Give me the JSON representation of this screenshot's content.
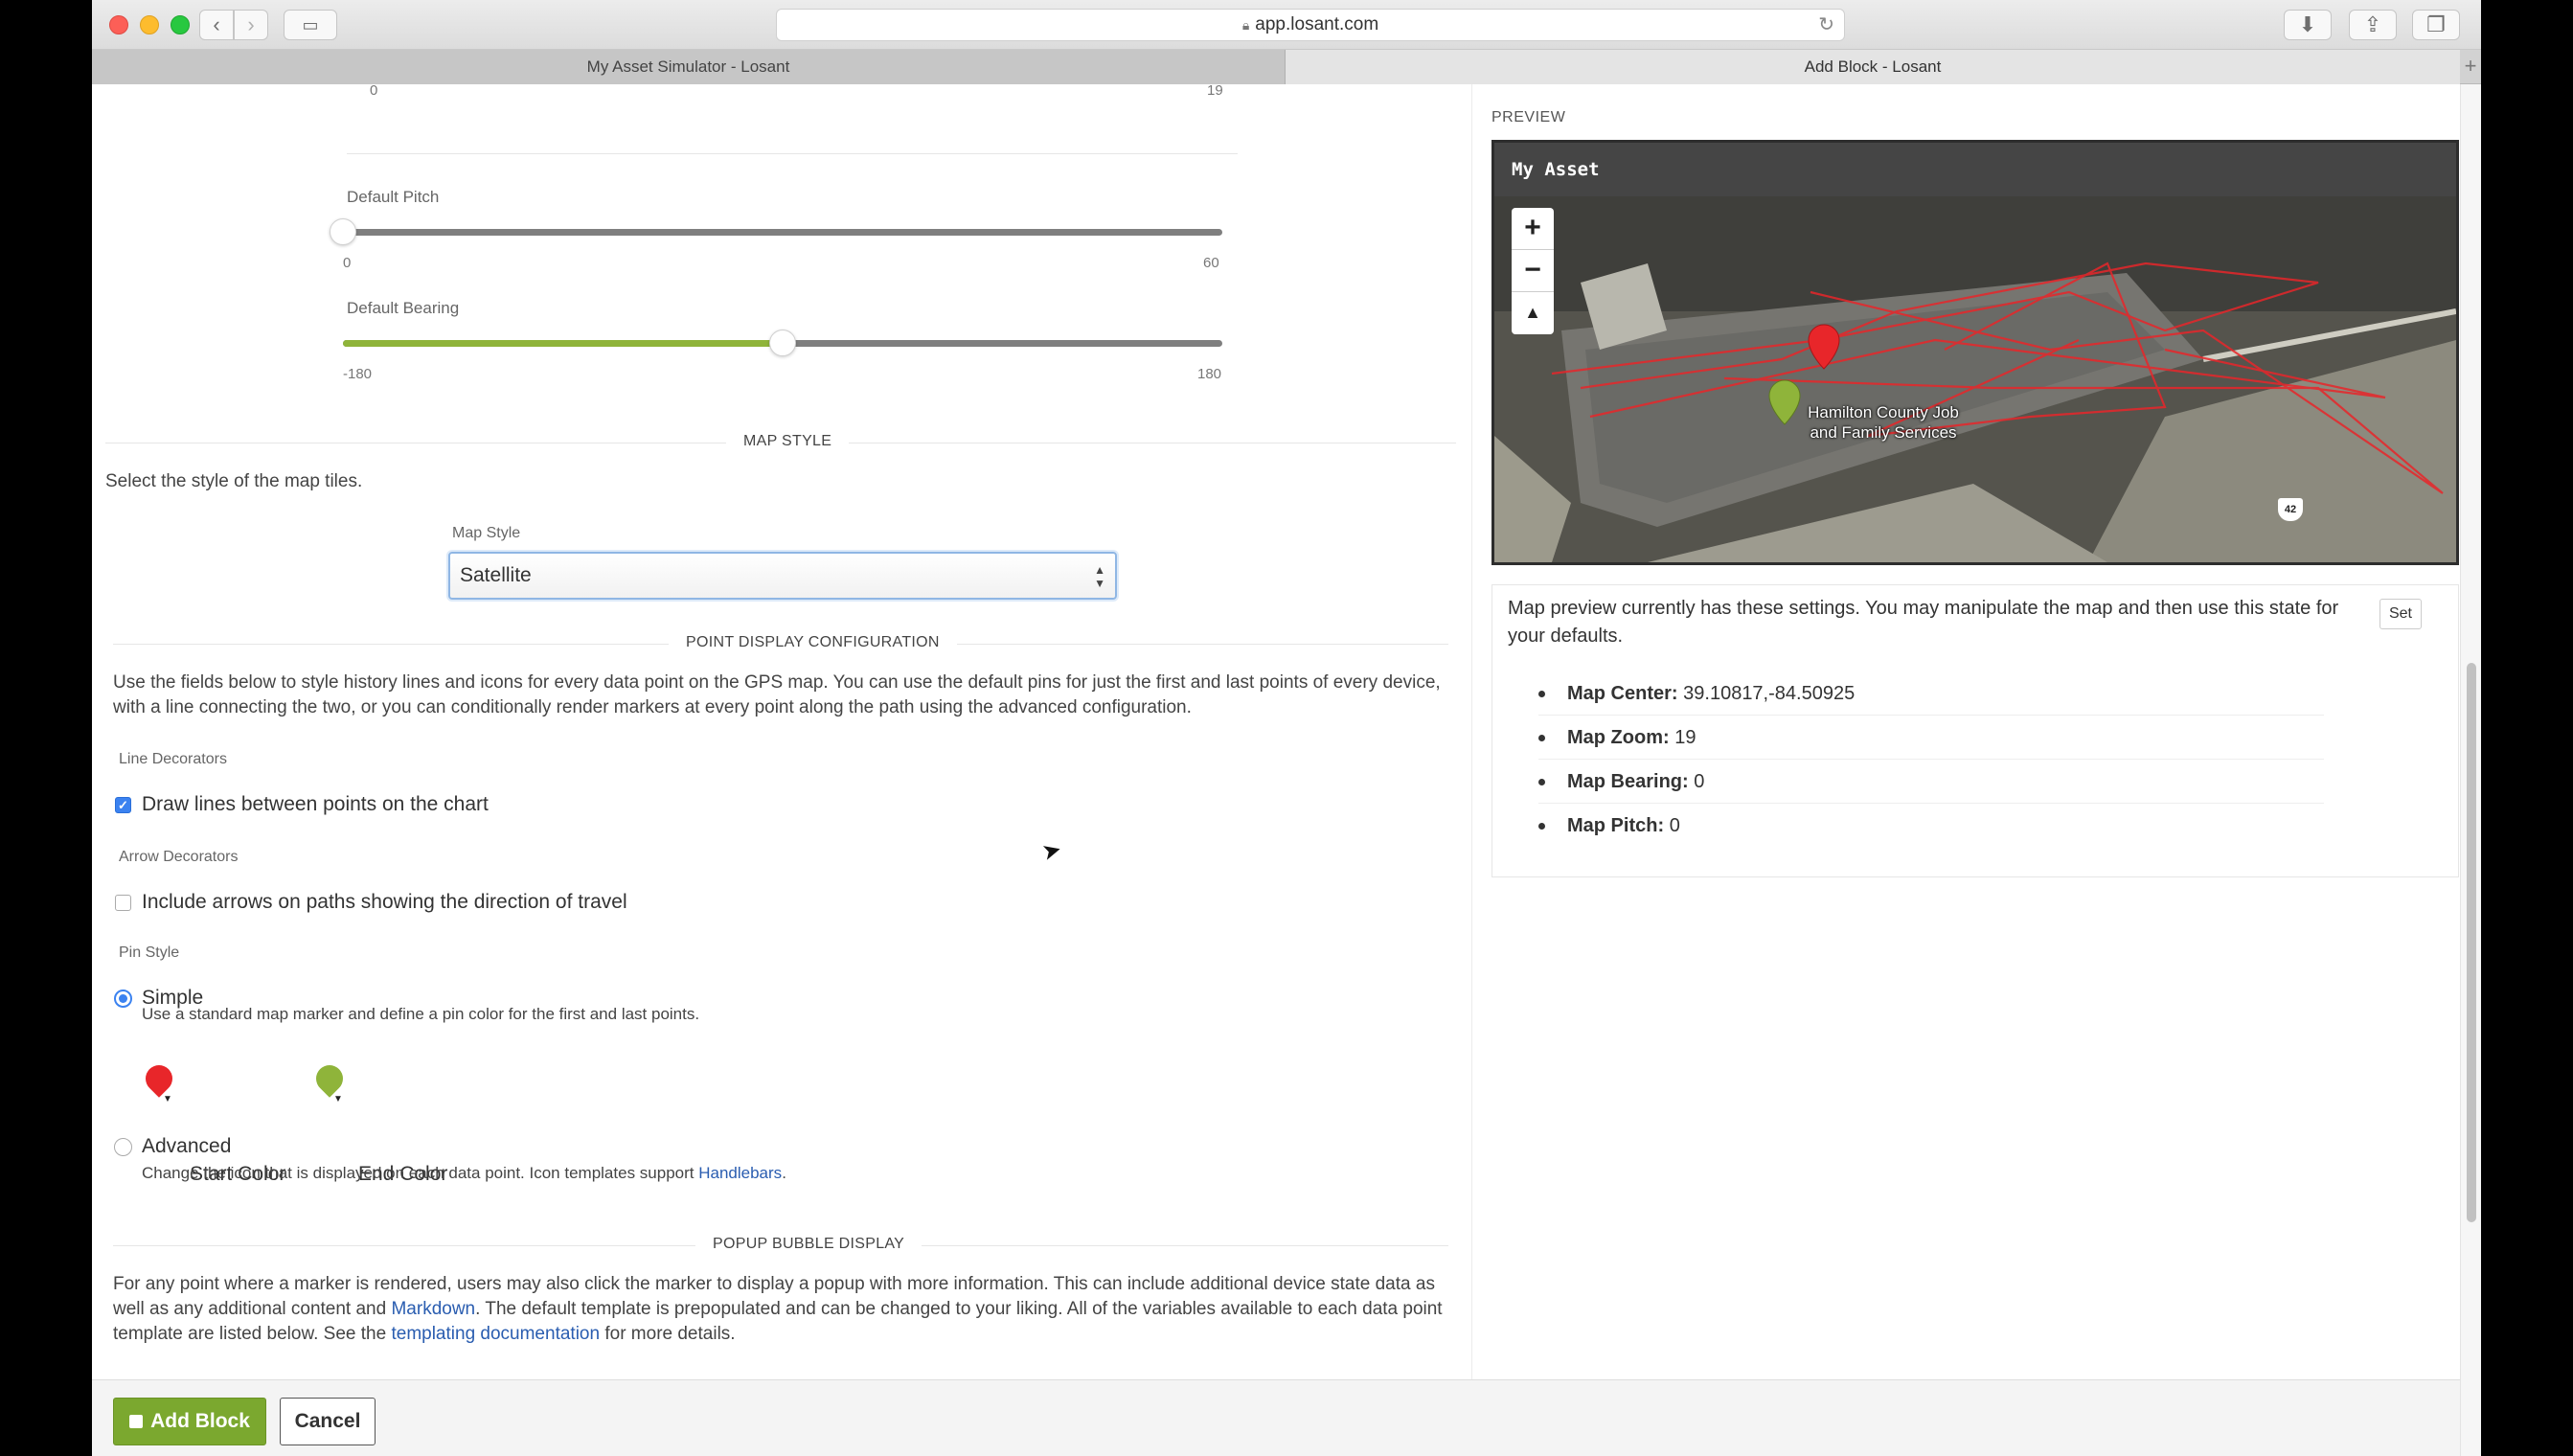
{
  "browser": {
    "url": "app.losant.com",
    "tabs": [
      "My Asset Simulator - Losant",
      "Add Block - Losant"
    ]
  },
  "sliders": {
    "zoom": {
      "min_label": "0",
      "max_label": "19"
    },
    "pitch": {
      "label": "Default Pitch",
      "min_label": "0",
      "max_label": "60",
      "value_fraction": 0.0
    },
    "bearing": {
      "label": "Default Bearing",
      "min_label": "-180",
      "max_label": "180",
      "value_fraction": 0.5
    }
  },
  "map_style": {
    "section_title": "MAP STYLE",
    "description": "Select the style of the map tiles.",
    "field_label": "Map Style",
    "selected": "Satellite"
  },
  "point_display": {
    "section_title": "POINT DISPLAY CONFIGURATION",
    "description": "Use the fields below to style history lines and icons for every data point on the GPS map. You can use the default pins for just the first and last points of every device, with a line connecting the two, or you can conditionally render markers at every point along the path using the advanced configuration.",
    "line_decorators_label": "Line Decorators",
    "draw_lines_label": "Draw lines between points on the chart",
    "draw_lines_checked": true,
    "arrow_decorators_label": "Arrow Decorators",
    "arrows_label": "Include arrows on paths showing the direction of travel",
    "arrows_checked": false,
    "pin_style_label": "Pin Style",
    "simple_label": "Simple",
    "simple_description": "Use a standard map marker and define a pin color for the first and last points.",
    "start_color_label": "Start Color",
    "end_color_label": "End Color",
    "start_color": "#e8262a",
    "end_color": "#8fb43a",
    "advanced_label": "Advanced",
    "advanced_description": "Change the icon that is displayed on each data point. Icon templates support",
    "advanced_link": "Handlebars",
    "advanced_suffix": "."
  },
  "popup": {
    "section_title": "POPUP BUBBLE DISPLAY",
    "text_1": "For any point where a marker is rendered, users may also click the marker to display a popup with more information. This can include additional device state data as well as any additional content and",
    "link_1": "Markdown",
    "text_2": ". The default template is prepopulated and can be changed to your liking. All of the variables available to each data point template are listed below. See the",
    "link_2": "templating documentation",
    "text_3": "for more details."
  },
  "footer": {
    "add_block_label": "Add Block",
    "cancel_label": "Cancel"
  },
  "preview": {
    "label": "PREVIEW",
    "widget_title": "My Asset",
    "map_place_label": "Hamilton County Job and Family Services",
    "route_shield": "42",
    "info_text": "Map preview currently has these settings. You may manipulate the map and then use this state for your defaults.",
    "set_label": "Set",
    "settings": [
      {
        "key": "Map Center:",
        "value": "39.10817,-84.50925"
      },
      {
        "key": "Map Zoom:",
        "value": "19"
      },
      {
        "key": "Map Bearing:",
        "value": "0"
      },
      {
        "key": "Map Pitch:",
        "value": "0"
      }
    ]
  },
  "colors": {
    "accent_green": "#8fb43a",
    "button_green": "#7ba82f",
    "link_blue": "#2a5db0",
    "route_red": "#e8262a"
  }
}
